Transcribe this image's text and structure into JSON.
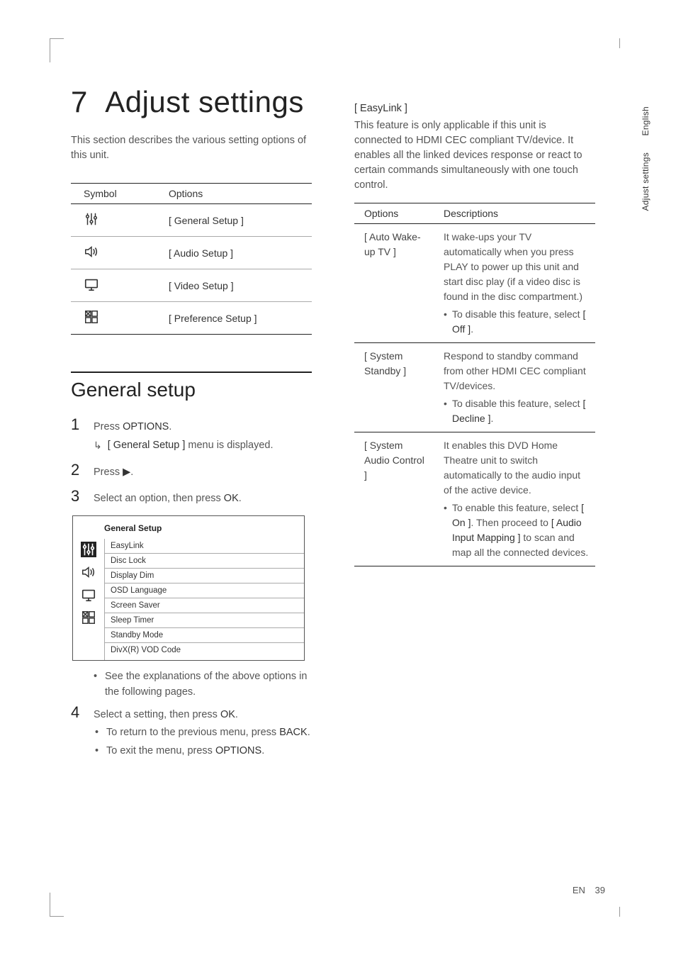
{
  "chapter": {
    "number": "7",
    "title": "Adjust settings"
  },
  "intro": "This section describes the various setting options of this unit.",
  "symbol_table": {
    "headers": [
      "Symbol",
      "Options"
    ],
    "rows": [
      {
        "icon": "sliders-icon",
        "option": "[ General Setup ]"
      },
      {
        "icon": "speaker-icon",
        "option": "[ Audio Setup ]"
      },
      {
        "icon": "monitor-icon",
        "option": "[ Video Setup ]"
      },
      {
        "icon": "grid-icon",
        "option": "[ Preference Setup ]"
      }
    ]
  },
  "section": {
    "title": "General setup"
  },
  "steps": {
    "s1": {
      "num": "1",
      "text_a": "Press ",
      "text_b": "OPTIONS",
      "text_c": ".",
      "sub_a": "[ General Setup ]",
      "sub_b": " menu is displayed."
    },
    "s2": {
      "num": "2",
      "text_a": "Press ",
      "text_b": "▶",
      "text_c": "."
    },
    "s3": {
      "num": "3",
      "text_a": "Select an option, then press ",
      "text_b": "OK",
      "text_c": "."
    },
    "s3_bullet": "See the explanations of the above options in the following pages.",
    "s4": {
      "num": "4",
      "text_a": "Select a setting, then press ",
      "text_b": "OK",
      "text_c": "."
    },
    "s4_b1a": "To return to the previous menu, press ",
    "s4_b1b": "BACK",
    "s4_b1c": ".",
    "s4_b2a": "To exit the menu, press ",
    "s4_b2b": "OPTIONS",
    "s4_b2c": "."
  },
  "uibox": {
    "title": "General Setup",
    "items": [
      "EasyLink",
      "Disc Lock",
      "Display Dim",
      "OSD Language",
      "Screen Saver",
      "Sleep Timer",
      "Standby Mode",
      "DivX(R) VOD Code"
    ]
  },
  "easylink": {
    "heading": "[ EasyLink ]",
    "desc": "This feature is only applicable if this unit is connected to HDMI CEC compliant TV/device.  It enables all the linked devices response or react to certain commands simultaneously with one touch control.",
    "headers": [
      "Options",
      "Descriptions"
    ],
    "rows": [
      {
        "name": "[ Auto Wake-up TV ]",
        "desc": "It wake-ups your TV automatically when you press PLAY to power up this unit and start disc play (if a video disc is found in the disc compartment.)",
        "bullet_pre": "To disable this feature, select ",
        "bullet_bold": "[ Off ]",
        "bullet_post": "."
      },
      {
        "name": "[ System Standby ]",
        "desc": "Respond to standby command from other HDMI CEC compliant TV/devices.",
        "bullet_pre": "To disable this feature, select ",
        "bullet_bold": "[ Decline ]",
        "bullet_post": "."
      },
      {
        "name": "[ System Audio Control ]",
        "desc": "It enables this DVD Home Theatre unit to switch automatically to the audio input of the active device.",
        "bullet_pre": "To enable this feature, select ",
        "bullet_bold": "[ On ]",
        "bullet_mid": ".  Then proceed to ",
        "bullet_bold2": "[ Audio Input Mapping ]",
        "bullet_post": " to scan and map all the connected devices."
      }
    ]
  },
  "sidetabs": [
    "English",
    "Adjust settings"
  ],
  "footer": {
    "lang": "EN",
    "page": "39"
  }
}
